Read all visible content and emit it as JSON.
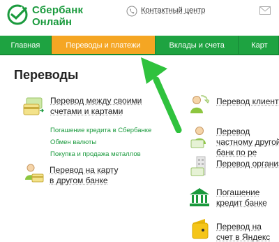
{
  "brand": {
    "line1": "Сбербанк",
    "line2": "Онлайн",
    "color": "#1a9a3d"
  },
  "header": {
    "contact_label": "Контактный центр",
    "contact_icon": "phone-icon",
    "mail_icon": "mail-icon"
  },
  "nav": {
    "items": [
      {
        "label": "Главная",
        "active": false
      },
      {
        "label": "Переводы и платежи",
        "active": true
      },
      {
        "label": "Вклады и счета",
        "active": false
      },
      {
        "label": "Карт",
        "active": false
      }
    ],
    "colors": {
      "bar": "#1ea341",
      "active": "#f5a623"
    }
  },
  "main": {
    "title": "Переводы",
    "left": [
      {
        "title": "Перевод между своими счетами и картами",
        "icon": "cards-transfer-icon"
      },
      {
        "title": "Перевод на карту в другом банке",
        "icon": "card-person-icon"
      }
    ],
    "sub_links": [
      "Погашение кредита в Сбербанке",
      "Обмен валюты",
      "Покупка и продажа металлов"
    ],
    "right": [
      {
        "title": "Перевод клиенту",
        "icon": "person-transfer-icon"
      },
      {
        "title": "Перевод частному другой банк по ре",
        "icon": "person-card-icon"
      },
      {
        "title": "Перевод организа",
        "icon": "organization-card-icon"
      },
      {
        "title": "Погашение кредит банке",
        "icon": "bank-icon"
      },
      {
        "title": "Перевод на счет в Яндекс Деньгах",
        "icon": "yandex-wallet-icon"
      }
    ]
  },
  "annotation": {
    "arrow_color": "#2fc23d"
  }
}
